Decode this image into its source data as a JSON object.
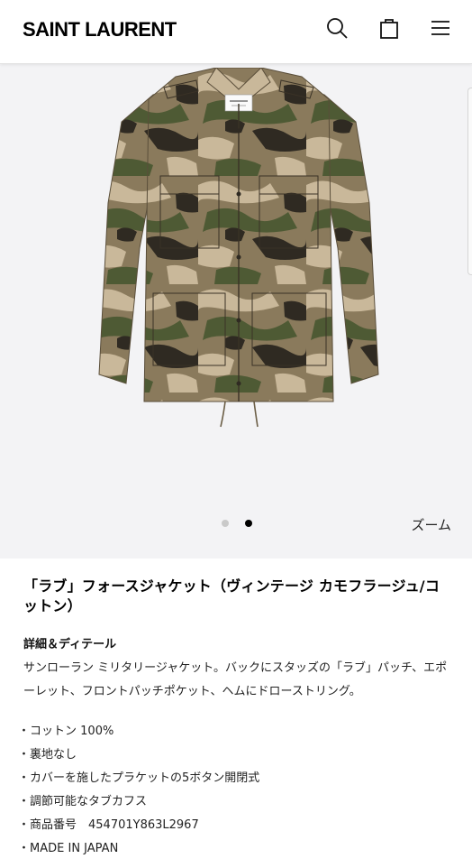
{
  "header": {
    "brand": "SAINT LAURENT",
    "search_icon": "search-icon",
    "bag_icon": "shopping-bag-icon",
    "menu_icon": "hamburger-menu-icon"
  },
  "gallery": {
    "image_count": 2,
    "active_index": 1,
    "zoom_label": "ズーム"
  },
  "product": {
    "title": "「ラブ」フォースジャケット（ヴィンテージ カモフラージュ/コットン）",
    "details_heading": "詳細＆ディテール",
    "description": "サンローラン ミリタリージャケット。バックにスタッズの「ラブ」パッチ、エポーレット、フロントパッチポケット、ヘムにドローストリング。",
    "specs": [
      "コットン 100%",
      "裏地なし",
      "カバーを施したプラケットの5ボタン開閉式",
      "調節可能なタブカフス",
      "商品番号　454701Y863L2967",
      "MADE IN JAPAN"
    ]
  },
  "colors": {
    "camo_base": "#8a7a5c",
    "camo_light": "#c9b89a",
    "camo_green": "#4e5a34",
    "camo_dark": "#2f2a22",
    "hero_bg": "#f3f3f5"
  }
}
